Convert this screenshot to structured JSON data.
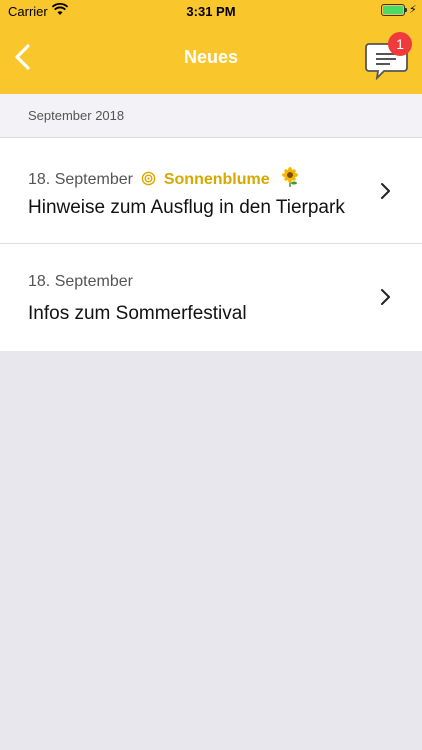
{
  "status": {
    "carrier": "Carrier",
    "time": "3:31 PM"
  },
  "navbar": {
    "title": "Neues",
    "badge_count": "1"
  },
  "section": {
    "label": "September 2018"
  },
  "items": [
    {
      "date": "18. September",
      "group": "Sonnenblume",
      "title": "Hinweise zum Ausflug in den Tierpark"
    },
    {
      "date": "18. September",
      "title": "Infos zum Sommerfestival"
    }
  ],
  "colors": {
    "accent": "#f9c62b",
    "group": "#d7a900",
    "badge": "#ef3b3b",
    "background": "#e8e7ee"
  }
}
